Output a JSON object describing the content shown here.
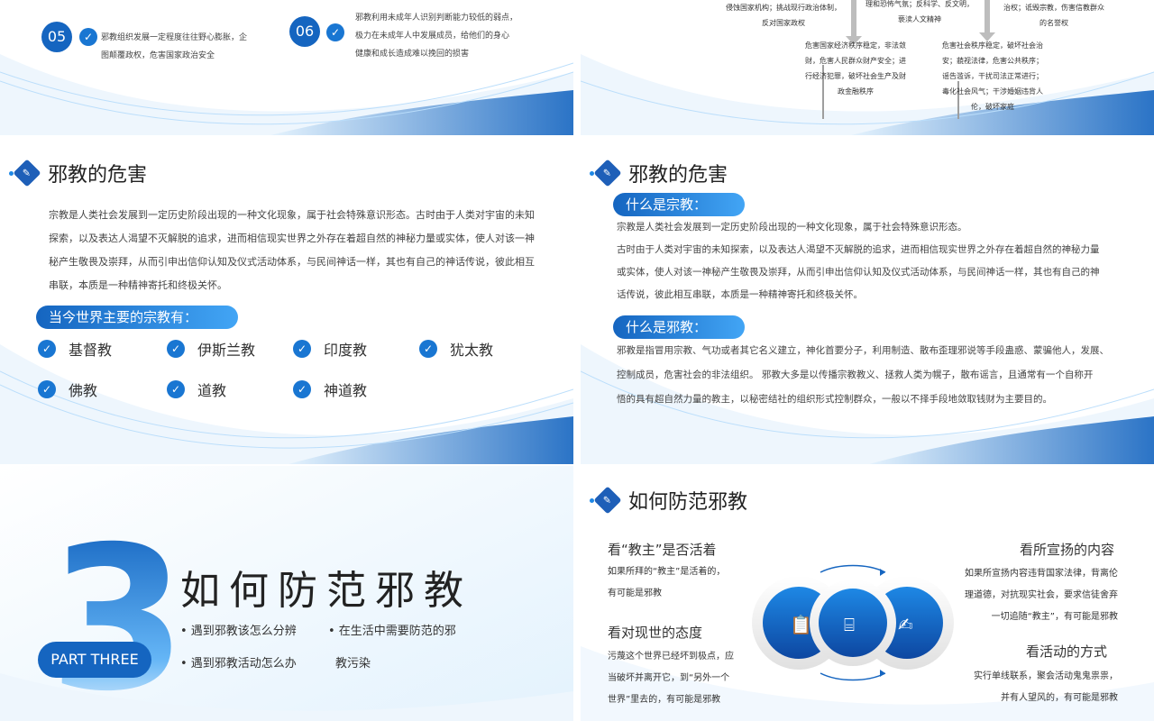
{
  "slide1": {
    "item5": {
      "num": "05",
      "line1": "邪教组织发展一定程度往往野心膨胀，企",
      "line2": "图颠覆政权，危害国家政治安全"
    },
    "item6": {
      "num": "06",
      "line1": "邪教利用未成年人识别判断能力较低的弱点，",
      "line2": "极力在未成年人中发展成员，给他们的身心",
      "line3": "健康和成长造成难以挽回的损害"
    }
  },
  "slide2": {
    "a1": "侵蚀国家机构；挑战现行政治体制，",
    "a2": "反对国家政权",
    "b1": "理和恐怖气氛；反科学、反文明，",
    "b2": "亵渎人文精神",
    "c1": "治权；诋毁宗教，伤害信教群众",
    "c2": "的名誉权",
    "d1": "危害国家经济秩序稳定，非法敛",
    "d2": "财，危害人民群众财产安全；进",
    "d3": "行经济犯罪，破坏社会生产及财",
    "d4": "政金融秩序",
    "e1": "危害社会秩序稳定，破坏社会治",
    "e2": "安；藐视法律，危害公共秩序；",
    "e3": "谣告滥诉，干扰司法正常进行；",
    "e4": "毒化社会风气；干涉婚姻违背人",
    "e5": "伦，破坏家庭"
  },
  "slide3": {
    "title": "邪教的危害",
    "p1": "宗教是人类社会发展到一定历史阶段出现的一种文化现象，属于社会特殊意识形态。古时由于人类对宇宙的未知",
    "p2": "探索，以及表达人渴望不灭解脱的追求，进而相信现实世界之外存在着超自然的神秘力量或实体，使人对该一神",
    "p3": "秘产生敬畏及崇拜，从而引申出信仰认知及仪式活动体系，与民间神话一样，其也有自己的神话传说，彼此相互",
    "p4": "串联，本质是一种精神寄托和终极关怀。",
    "pill": "当今世界主要的宗教有：",
    "religions": [
      "基督教",
      "伊斯兰教",
      "印度教",
      "犹太教",
      "佛教",
      "道教",
      "神道教"
    ]
  },
  "slide4": {
    "title": "邪教的危害",
    "pill1": "什么是宗教：",
    "q1": "宗教是人类社会发展到一定历史阶段出现的一种文化现象，属于社会特殊意识形态。",
    "q2": "古时由于人类对宇宙的未知探索，以及表达人渴望不灭解脱的追求，进而相信现实世界之外存在着超自然的神秘力量",
    "q3": "或实体，使人对该一神秘产生敬畏及崇拜，从而引申出信仰认知及仪式活动体系，与民间神话一样，其也有自己的神",
    "q4": "话传说，彼此相互串联，本质是一种精神寄托和终极关怀。",
    "pill2": "什么是邪教：",
    "r1": "邪教是指冒用宗教、气功或者其它名义建立，神化首要分子，利用制造、散布歪理邪说等手段蛊惑、蒙骗他人，发展、",
    "r2": "控制成员，危害社会的非法组织。 邪教大多是以传播宗教教义、拯救人类为幌子，散布谣言，且通常有一个自称开",
    "r3": "悟的具有超自然力量的教主，以秘密结社的组织形式控制群众，一般以不择手段地敛取钱财为主要目的。"
  },
  "slide5": {
    "big": "3",
    "part": "PART THREE",
    "heading": "如何防范邪教",
    "b1": "• 遇到邪教该怎么分辨",
    "b2": "• 在生活中需要防范的邪",
    "b2b": "教污染",
    "b3": "• 遇到邪教活动怎么办"
  },
  "slide6": {
    "title": "如何防范邪教",
    "l1h": "看“教主”是否活着",
    "l1a": "如果所拜的“教主”是活着的，",
    "l1b": "有可能是邪教",
    "l2h": "看对现世的态度",
    "l2a": "污蔑这个世界已经坏到极点，应",
    "l2b": "当破坏并离开它，到“另外一个",
    "l2c": "世界”里去的，有可能是邪教",
    "r1h": "看所宣扬的内容",
    "r1a": "如果所宣扬内容违背国家法律，背离伦",
    "r1b": "理道德，对抗现实社会，要求信徒舍弃",
    "r1c": "一切追随“教主”，有可能是邪教",
    "r2h": "看活动的方式",
    "r2a": "实行单线联系，聚会活动鬼鬼祟祟，",
    "r2b": "并有人望风的，有可能是邪教"
  },
  "colors": {
    "primary": "#1565c0",
    "accent": "#42a5f5",
    "light": "#e3f2fd"
  }
}
